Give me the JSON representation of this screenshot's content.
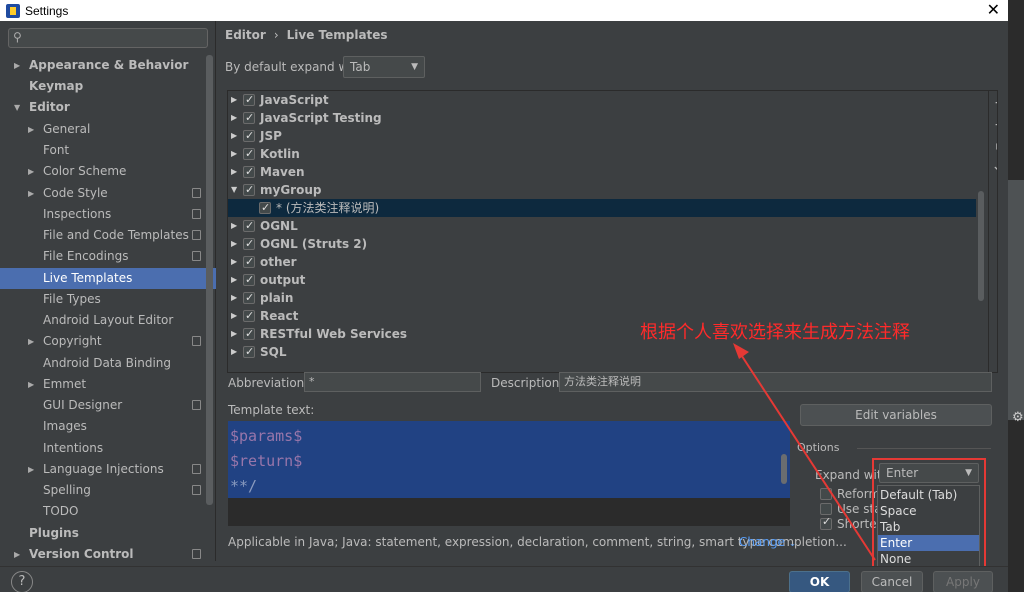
{
  "window": {
    "title": "Settings",
    "close_glyph": "✕"
  },
  "sidebar": {
    "search_placeholder": "",
    "items": [
      {
        "label": "Appearance & Behavior"
      },
      {
        "label": "Keymap"
      },
      {
        "label": "Editor"
      },
      {
        "label": "General"
      },
      {
        "label": "Font"
      },
      {
        "label": "Color Scheme"
      },
      {
        "label": "Code Style"
      },
      {
        "label": "Inspections"
      },
      {
        "label": "File and Code Templates"
      },
      {
        "label": "File Encodings"
      },
      {
        "label": "Live Templates"
      },
      {
        "label": "File Types"
      },
      {
        "label": "Android Layout Editor"
      },
      {
        "label": "Copyright"
      },
      {
        "label": "Android Data Binding"
      },
      {
        "label": "Emmet"
      },
      {
        "label": "GUI Designer"
      },
      {
        "label": "Images"
      },
      {
        "label": "Intentions"
      },
      {
        "label": "Language Injections"
      },
      {
        "label": "Spelling"
      },
      {
        "label": "TODO"
      },
      {
        "label": "Plugins"
      },
      {
        "label": "Version Control"
      }
    ]
  },
  "breadcrumb": {
    "part1": "Editor",
    "sep": "›",
    "part2": "Live Templates"
  },
  "default_expand": {
    "label": "By default expand with",
    "value": "Tab"
  },
  "templates": {
    "groups": [
      {
        "name": "JavaScript"
      },
      {
        "name": "JavaScript Testing"
      },
      {
        "name": "JSP"
      },
      {
        "name": "Kotlin"
      },
      {
        "name": "Maven"
      },
      {
        "name": "myGroup"
      },
      {
        "name": "* (方法类注释说明)"
      },
      {
        "name": "OGNL"
      },
      {
        "name": "OGNL (Struts 2)"
      },
      {
        "name": "other"
      },
      {
        "name": "output"
      },
      {
        "name": "plain"
      },
      {
        "name": "React"
      },
      {
        "name": "RESTful Web Services"
      },
      {
        "name": "SQL"
      }
    ],
    "tools": {
      "add": "+",
      "remove": "−",
      "copy": "⧉",
      "restore": "↶"
    }
  },
  "abbreviation": {
    "label": "Abbreviation:",
    "value": "*"
  },
  "description": {
    "label": "Description:",
    "value": "方法类注释说明"
  },
  "template_text": {
    "label": "Template text:",
    "lines": [
      "$params$",
      "$return$",
      "**/"
    ]
  },
  "edit_variables": "Edit variables",
  "options": {
    "title": "Options",
    "expand_with_label": "Expand with",
    "expand_with_value": "Enter",
    "reformat": "Reforma",
    "use_static": "Use stat",
    "shorten": "Shorten"
  },
  "expand_popup": {
    "options": [
      "Default (Tab)",
      "Space",
      "Tab",
      "Enter",
      "None"
    ],
    "selected": "Enter"
  },
  "applicable": {
    "text": "Applicable in Java; Java: statement, expression, declaration, comment, string, smart type completion...",
    "change": "Change"
  },
  "annotation": {
    "text": "根据个人喜欢选择来生成方法注释",
    "color": "#ff2a2a"
  },
  "buttons": {
    "ok": "OK",
    "cancel": "Cancel",
    "apply": "Apply",
    "help": "?"
  },
  "colors": {
    "selection": "#4b6eaf",
    "editor_selection": "#214283",
    "accent_link": "#589df6"
  }
}
